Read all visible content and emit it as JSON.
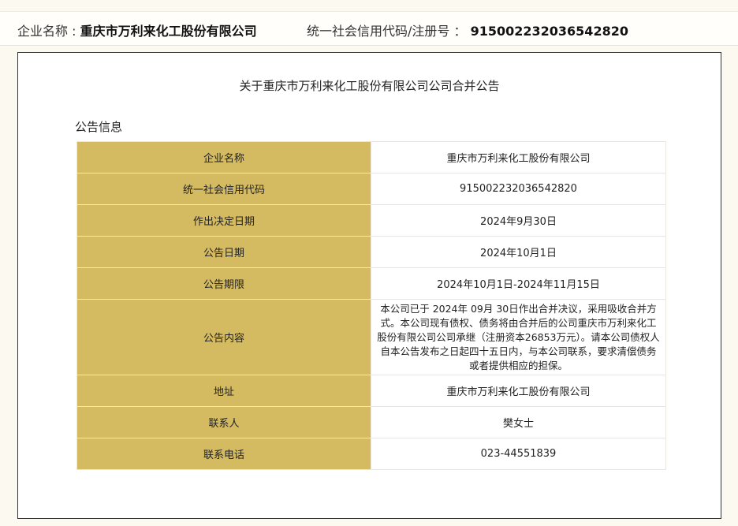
{
  "header": {
    "company_label": "企业名称 : ",
    "company_name": "重庆市万利来化工股份有限公司",
    "code_label": "统一社会信用代码/注册号 ： ",
    "code_value": "915002232036542820"
  },
  "notice": {
    "title": "关于重庆市万利来化工股份有限公司公司合并公告",
    "section_title": "公告信息",
    "rows": [
      {
        "label": "企业名称",
        "value": "重庆市万利来化工股份有限公司"
      },
      {
        "label": "统一社会信用代码",
        "value": "915002232036542820"
      },
      {
        "label": "作出决定日期",
        "value": "2024年9月30日"
      },
      {
        "label": "公告日期",
        "value": "2024年10月1日"
      },
      {
        "label": "公告期限",
        "value": "2024年10月1日-2024年11月15日"
      },
      {
        "label": "公告内容",
        "value": "本公司已于 2024年 09月 30日作出合并决议，采用吸收合并方式。本公司现有债权、债务将由合并后的公司重庆市万利来化工股份有限公司公司承继（注册资本26853万元）。请本公司债权人自本公告发布之日起四十五日内，与本公司联系，要求清偿债务或者提供相应的担保。"
      },
      {
        "label": "地址",
        "value": "重庆市万利来化工股份有限公司"
      },
      {
        "label": "联系人",
        "value": "樊女士"
      },
      {
        "label": "联系电话",
        "value": "023-44551839"
      }
    ]
  },
  "colors": {
    "label_cell_bg": "#d4bb62",
    "page_bg": "#fcfaf0"
  }
}
